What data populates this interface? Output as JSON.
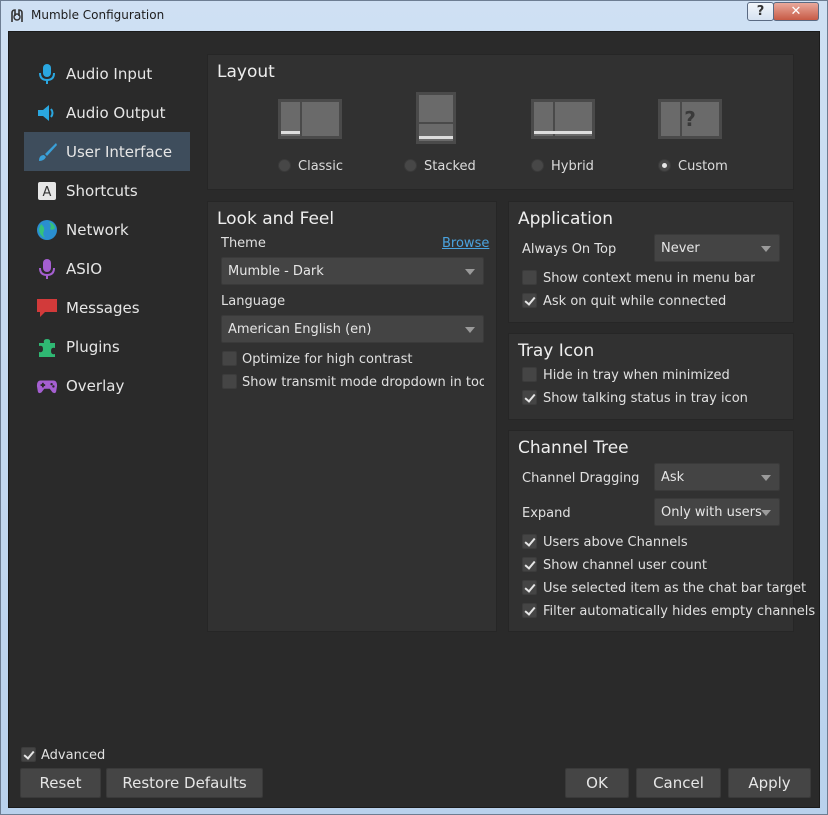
{
  "window": {
    "title": "Mumble Configuration",
    "help": "?",
    "close": "✕"
  },
  "sidebar": {
    "items": [
      {
        "label": "Audio Input",
        "icon": "microphone-icon",
        "color": "#2aa7e0"
      },
      {
        "label": "Audio Output",
        "icon": "speaker-icon",
        "color": "#2aa7e0"
      },
      {
        "label": "User Interface",
        "icon": "paintbrush-icon",
        "color": "#3aa0d8",
        "active": true
      },
      {
        "label": "Shortcuts",
        "icon": "keyboard-key-icon",
        "color": "#dddddd"
      },
      {
        "label": "Network",
        "icon": "globe-icon",
        "color": "#2fb873"
      },
      {
        "label": "ASIO",
        "icon": "asio-microphone-icon",
        "color": "#a55fd1"
      },
      {
        "label": "Messages",
        "icon": "speech-bubble-icon",
        "color": "#d23a3a"
      },
      {
        "label": "Plugins",
        "icon": "puzzle-piece-icon",
        "color": "#2fb873"
      },
      {
        "label": "Overlay",
        "icon": "gamepad-icon",
        "color": "#a55fd1"
      }
    ]
  },
  "layout": {
    "title": "Layout",
    "options": [
      {
        "label": "Classic",
        "checked": false,
        "icon": "layout-classic-icon"
      },
      {
        "label": "Stacked",
        "checked": false,
        "icon": "layout-stacked-icon"
      },
      {
        "label": "Hybrid",
        "checked": false,
        "icon": "layout-hybrid-icon"
      },
      {
        "label": "Custom",
        "checked": true,
        "icon": "layout-custom-icon",
        "mark": "?"
      }
    ]
  },
  "look": {
    "title": "Look and Feel",
    "theme_label": "Theme",
    "browse": "Browse",
    "theme_value": "Mumble - Dark",
    "language_label": "Language",
    "language_value": "American English (en)",
    "high_contrast": {
      "label": "Optimize for high contrast",
      "checked": false
    },
    "transmit_dropdown": {
      "label": "Show transmit mode dropdown in toolbar",
      "checked": false
    }
  },
  "application": {
    "title": "Application",
    "always_on_top_label": "Always On Top",
    "always_on_top_value": "Never",
    "context_menu": {
      "label": "Show context menu in menu bar",
      "checked": false
    },
    "ask_on_quit": {
      "label": "Ask on quit while connected",
      "checked": true
    }
  },
  "tray": {
    "title": "Tray Icon",
    "hide_in_tray": {
      "label": "Hide in tray when minimized",
      "checked": false
    },
    "talking_status": {
      "label": "Show talking status in tray icon",
      "checked": true
    }
  },
  "channel_tree": {
    "title": "Channel Tree",
    "dragging_label": "Channel Dragging",
    "dragging_value": "Ask",
    "expand_label": "Expand",
    "expand_value": "Only with users",
    "users_above": {
      "label": "Users above Channels",
      "checked": true
    },
    "user_count": {
      "label": "Show channel user count",
      "checked": true
    },
    "chat_target": {
      "label": "Use selected item as the chat bar target",
      "checked": true
    },
    "hide_empty": {
      "label": "Filter automatically hides empty channels",
      "checked": true
    }
  },
  "footer": {
    "advanced": {
      "label": "Advanced",
      "checked": true
    },
    "reset": "Reset",
    "restore": "Restore Defaults",
    "ok": "OK",
    "cancel": "Cancel",
    "apply": "Apply"
  }
}
